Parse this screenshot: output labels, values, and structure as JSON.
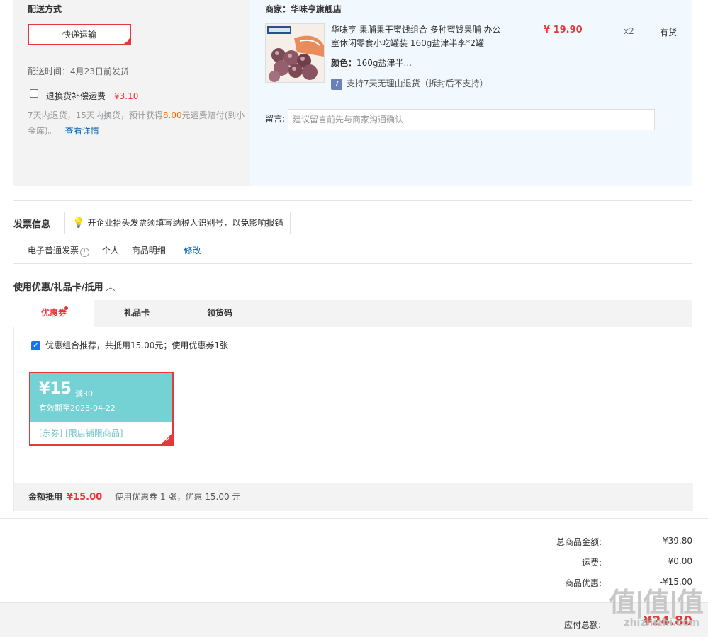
{
  "delivery": {
    "title": "配送方式",
    "shipping_method": "快递运输",
    "ship_time": "配送时间：4月23日前发货",
    "insurance_label": "退换货补偿运费",
    "insurance_price": "¥3.10",
    "insurance_desc_1": "7天内退货，15天内换货，预计获得",
    "insurance_desc_amount": "8.00",
    "insurance_desc_2": "元运费赔付(到小金库)。",
    "insurance_link": "查看详情"
  },
  "merchant": {
    "name": "商家：华味亨旗舰店",
    "product": {
      "title": "华味亨 果脯果干蜜饯组合 多种蜜饯果脯 办公室休闲零食小吃罐装 160g盐津半李*2罐",
      "color_label": "颜色：",
      "color_value": "160g盐津半...",
      "return_policy": "支持7天无理由退货（拆封后不支持）",
      "price": "¥ 19.90",
      "qty": "x2",
      "stock": "有货"
    },
    "message_label": "留言:",
    "message_placeholder": "建议留言前先与商家沟通确认"
  },
  "invoice": {
    "title": "发票信息",
    "tip": "开企业抬头发票须填写纳税人识别号，以免影响报销",
    "type": "电子普通发票",
    "title_type": "个人",
    "content": "商品明细",
    "edit": "修改"
  },
  "coupon": {
    "section_title": "使用优惠/礼品卡/抵用",
    "tabs": [
      "优惠券",
      "礼品卡",
      "领货码"
    ],
    "combo_text": "优惠组合推荐，共抵用15.00元；使用优惠券1张",
    "card": {
      "amount": "¥15",
      "condition": "满30",
      "validity": "有效期至2023-04-22",
      "tags": "[东券] [限店铺限商品]"
    },
    "deduct_label": "金额抵用",
    "deduct_amount": "¥15.00",
    "deduct_desc": "使用优惠券 1 张，优惠 15.00 元"
  },
  "totals": {
    "goods_label": "总商品金额:",
    "goods_value": "¥39.80",
    "shipping_label": "运费:",
    "shipping_value": "¥0.00",
    "discount_label": "商品优惠:",
    "discount_value": "-¥15.00",
    "pay_label": "应付总额:",
    "pay_value": "¥24.80"
  },
  "watermark": {
    "main": "值|值|值",
    "sub": "zhizhizhi.com"
  },
  "colors": {
    "accent_red": "#e4393c",
    "coupon_teal": "#74d2d5",
    "link_blue": "#005ea7"
  }
}
